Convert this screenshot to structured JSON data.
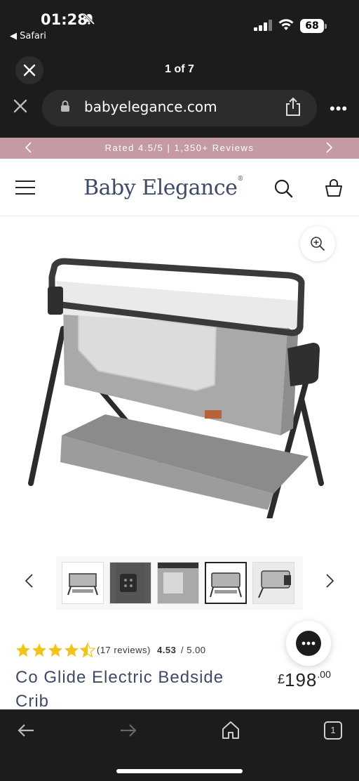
{
  "status_bar": {
    "time": "01:28",
    "back_app": "◀ Safari",
    "battery": "68"
  },
  "viewer": {
    "counter": "1 of 7"
  },
  "address_bar": {
    "url": "babyelegance.com"
  },
  "promo_banner": {
    "text": "Rated 4.5/5 | 1,350+ Reviews"
  },
  "header": {
    "logo": "Baby Elegance",
    "logo_mark": "®"
  },
  "product": {
    "review_count": "(17 reviews)",
    "rating": "4.53",
    "rating_max": "/ 5.00",
    "stars": 4.5,
    "title": "Co Glide Electric Bedside Crib",
    "currency": "£",
    "price_main": "198",
    "price_decimal": ".00"
  },
  "gallery": {
    "thumbnails": [
      "thumbnail-1",
      "thumbnail-2",
      "thumbnail-3",
      "thumbnail-4",
      "thumbnail-5"
    ],
    "active_thumbnail": 4
  },
  "toolbar": {
    "tab_count": "1"
  },
  "colors": {
    "promo_bg": "#c69aa2",
    "brand_navy": "#3e4a68",
    "star_yellow": "#f2c31b",
    "chrome_dark": "#1c1c1e"
  }
}
